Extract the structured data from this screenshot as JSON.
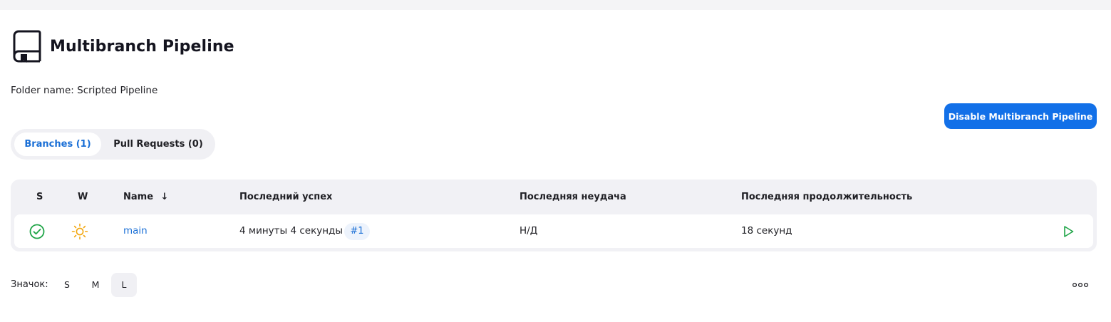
{
  "header": {
    "title": "Multibranch Pipeline",
    "icon": "book-icon"
  },
  "folder_name": "Folder name: Scripted Pipeline",
  "actions": {
    "disable_label": "Disable Multibranch Pipeline",
    "accent_color": "#1270e8"
  },
  "tabs": [
    {
      "label": "Branches (1)",
      "active": true
    },
    {
      "label": "Pull Requests (0)",
      "active": false
    }
  ],
  "table": {
    "columns": {
      "status": "S",
      "weather": "W",
      "name": "Name",
      "sort_arrow": "↓",
      "last_success": "Последний успех",
      "last_failure": "Последняя неудача",
      "last_duration": "Последняя продолжительность"
    },
    "rows": [
      {
        "status_icon": "success-check-icon",
        "weather_icon": "sunny-icon",
        "name": "main",
        "last_success": "4 минуты 4 секунды",
        "last_build": "#1",
        "last_failure": "Н/Д",
        "last_duration": "18 секунд",
        "action_icon": "play-icon"
      }
    ]
  },
  "icon_size": {
    "label": "Значок:",
    "options": [
      "S",
      "M",
      "L"
    ],
    "selected": "L"
  },
  "colors": {
    "success": "#1ea446",
    "weather_sun": "#f2a60f",
    "link": "#1a6fd6"
  }
}
